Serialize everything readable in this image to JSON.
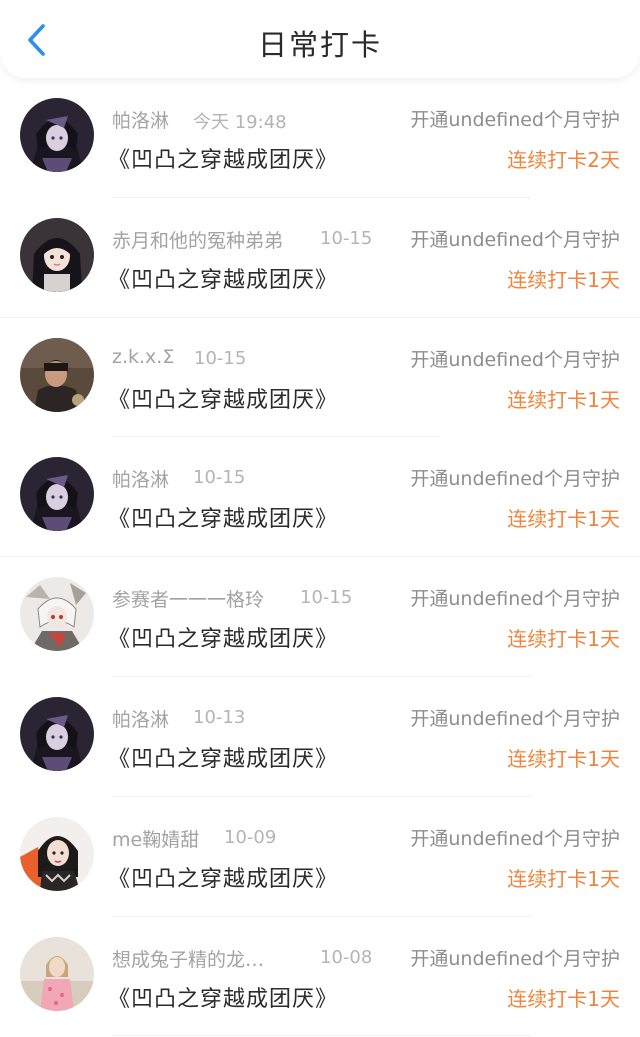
{
  "header": {
    "title": "日常打卡",
    "back_icon": "chevron-left-icon"
  },
  "colors": {
    "accent_blue": "#2f8cf0",
    "streak_orange": "#f0843c"
  },
  "entries": [
    {
      "name": "帕洛淋",
      "time": "今天 19:48",
      "guard": "开通undefined个月守护",
      "book": "《凹凸之穿越成团厌》",
      "streak": "连续打卡2天",
      "avatar": "anime-girl-dark-purple"
    },
    {
      "name": "赤月和他的冤种弟弟",
      "time": "10-15",
      "guard": "开通undefined个月守护",
      "book": "《凹凸之穿越成团厌》",
      "streak": "连续打卡1天",
      "avatar": "anime-girl-black-hair"
    },
    {
      "name": "z.k.x.Σ",
      "time": "10-15",
      "guard": "开通undefined个月守护",
      "book": "《凹凸之穿越成团厌》",
      "streak": "连续打卡1天",
      "avatar": "photo-man-dark"
    },
    {
      "name": "帕洛淋",
      "time": "10-15",
      "guard": "开通undefined个月守护",
      "book": "《凹凸之穿越成团厌》",
      "streak": "连续打卡1天",
      "avatar": "anime-girl-dark-purple"
    },
    {
      "name": "参赛者一一一格玲",
      "time": "10-15",
      "guard": "开通undefined个月守护",
      "book": "《凹凸之穿越成团厌》",
      "streak": "连续打卡1天",
      "avatar": "anime-white-hair-sketch"
    },
    {
      "name": "帕洛淋",
      "time": "10-13",
      "guard": "开通undefined个月守护",
      "book": "《凹凸之穿越成团厌》",
      "streak": "连续打卡1天",
      "avatar": "anime-girl-dark-purple"
    },
    {
      "name": "me鞠婧甜",
      "time": "10-09",
      "guard": "开通undefined个月守护",
      "book": "《凹凸之穿越成团厌》",
      "streak": "连续打卡1天",
      "avatar": "photo-girl-red-orange"
    },
    {
      "name": "想成兔子精的龙…",
      "time": "10-08",
      "guard": "开通undefined个月守护",
      "book": "《凹凸之穿越成团厌》",
      "streak": "连续打卡1天",
      "avatar": "photo-girl-pink-beach"
    }
  ]
}
